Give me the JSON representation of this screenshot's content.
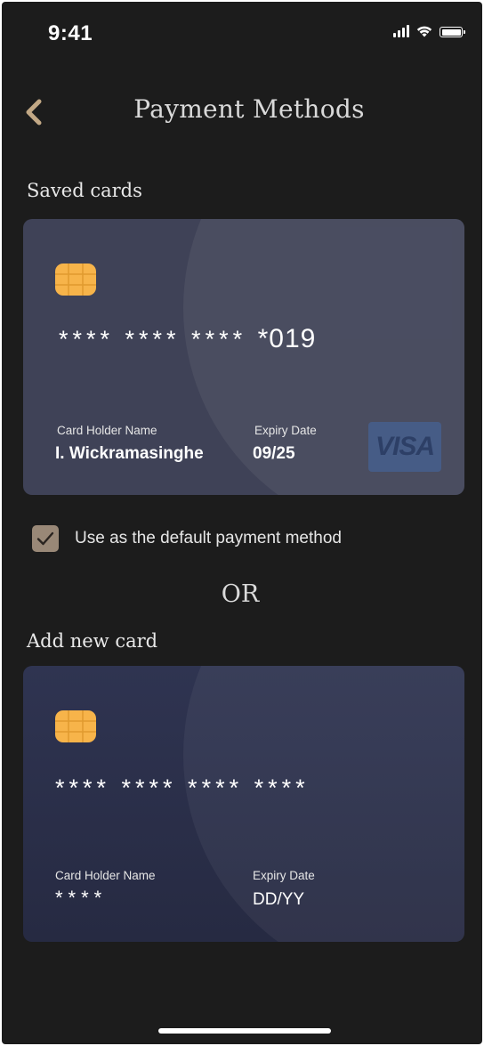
{
  "status_bar": {
    "time": "9:41",
    "icons": [
      "cellular-signal-icon",
      "wifi-icon",
      "battery-icon"
    ]
  },
  "header": {
    "back_icon": "chevron-left-icon",
    "title": "Payment Methods"
  },
  "saved_cards": {
    "section_label": "Saved cards",
    "card": {
      "number_mask": "**** **** ****",
      "number_tail": "*019",
      "holder_label": "Card Holder Name",
      "holder_value": "I. Wickramasinghe",
      "expiry_label": "Expiry Date",
      "expiry_value": "09/25",
      "brand": "VISA",
      "background_color": "#3f4257"
    }
  },
  "default_method": {
    "checked": true,
    "label": "Use as the default payment method"
  },
  "divider_text": "OR",
  "new_card": {
    "section_label": "Add new card",
    "card": {
      "number_mask": "**** **** **** ****",
      "holder_label": "Card Holder Name",
      "holder_value": "****",
      "expiry_label": "Expiry Date",
      "expiry_value": "DD/YY",
      "background_color": "#2f3451"
    }
  },
  "colors": {
    "background": "#1c1c1c",
    "accent": "#998877",
    "chip": "#f7b44a",
    "text": "#ffffff"
  }
}
